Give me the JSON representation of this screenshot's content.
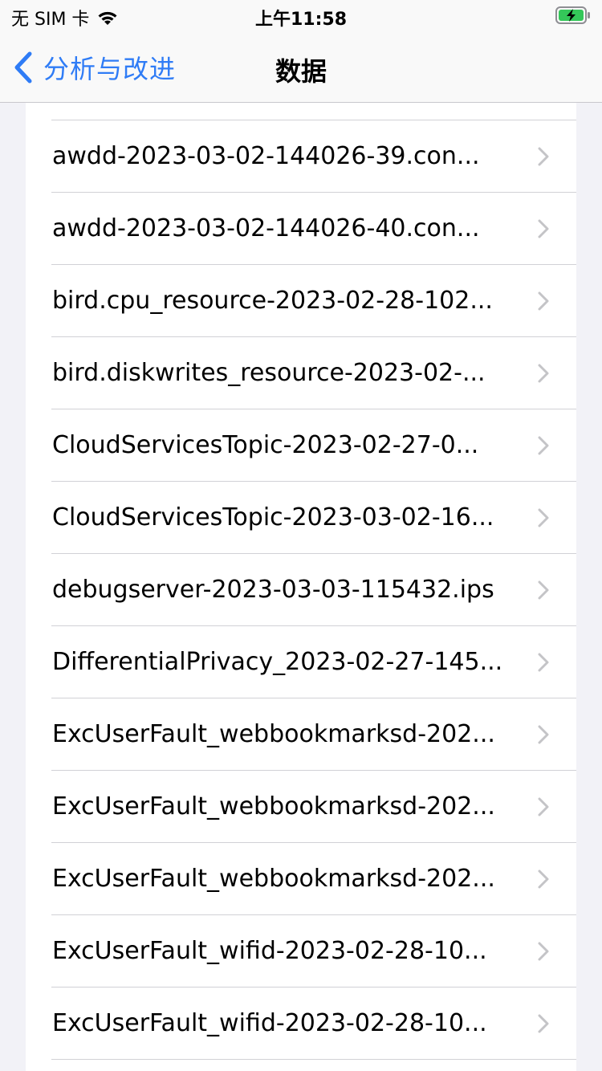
{
  "status_bar": {
    "carrier": "无 SIM 卡",
    "time": "上午11:58",
    "icons": [
      "wifi-icon",
      "battery-charging-icon"
    ]
  },
  "nav": {
    "back_label": "分析与改进",
    "title": "数据"
  },
  "list": {
    "items": [
      "awdd-2023-03-02-144026-39.con...",
      "awdd-2023-03-02-144026-40.con...",
      "bird.cpu_resource-2023-02-28-102...",
      "bird.diskwrites_resource-2023-02-...",
      "CloudServicesTopic-2023-02-27-0...",
      "CloudServicesTopic-2023-03-02-16...",
      "debugserver-2023-03-03-115432.ips",
      "DifferentialPrivacy_2023-02-27-145...",
      "ExcUserFault_webbookmarksd-202...",
      "ExcUserFault_webbookmarksd-202...",
      "ExcUserFault_webbookmarksd-202...",
      "ExcUserFault_wifid-2023-02-28-10...",
      "ExcUserFault_wifid-2023-02-28-10..."
    ]
  },
  "colors": {
    "accent": "#2f7cf6",
    "chevron": "#c4c4c7",
    "background": "#f2f2f7"
  }
}
